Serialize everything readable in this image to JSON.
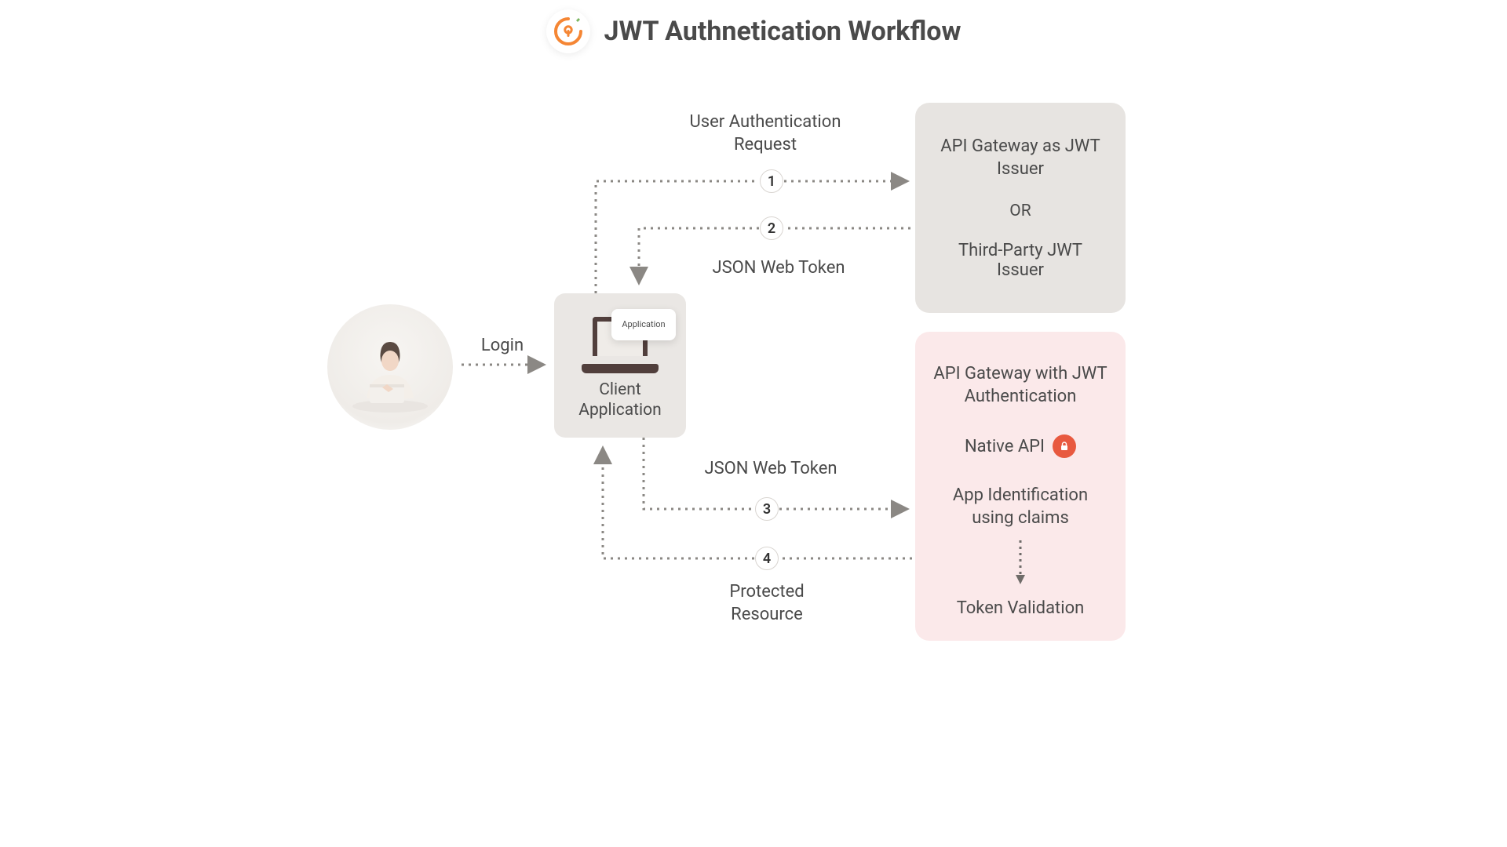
{
  "title": "JWT Authnetication Workflow",
  "login_label": "Login",
  "client": {
    "app_card": "Application",
    "label_line1": "Client",
    "label_line2": "Application"
  },
  "issuer": {
    "line1": "API Gateway as JWT Issuer",
    "or": "OR",
    "line2": "Third-Party JWT Issuer"
  },
  "auth": {
    "title": "API Gateway with JWT Authentication",
    "native": "Native API",
    "claims": "App Identification using claims",
    "validation": "Token Validation"
  },
  "flow_labels": {
    "step1": "User Authentication Request",
    "step2": "JSON Web Token",
    "step3": "JSON Web Token",
    "step4": "Protected Resource"
  },
  "steps": {
    "s1": "1",
    "s2": "2",
    "s3": "3",
    "s4": "4"
  }
}
